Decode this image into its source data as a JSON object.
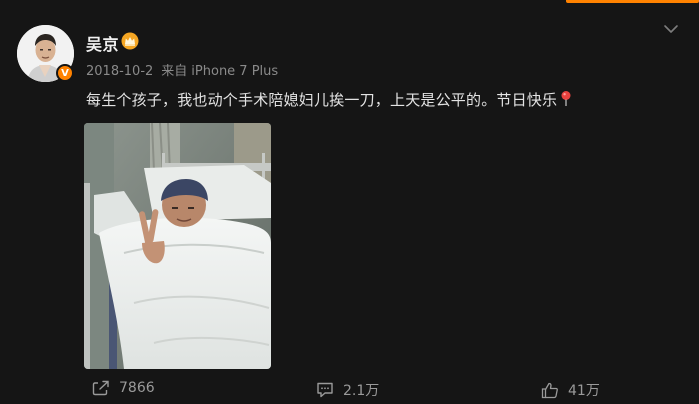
{
  "post": {
    "author": "吴京",
    "date": "2018-10-2",
    "source_prefix": "来自",
    "device": "iPhone 7 Plus",
    "text": "每生个孩子，我也动个手术陪媳妇儿挨一刀，上天是公平的。节日快乐",
    "verified_badge": "V"
  },
  "actions": {
    "repost_count": "7866",
    "comment_count": "2.1万",
    "like_count": "41万"
  },
  "icons": {
    "crown": "member-crown-icon",
    "chevron": "chevron-down-icon",
    "pin": "red-pin-icon",
    "repost": "repost-icon",
    "comment": "comment-icon",
    "like": "thumbs-up-icon"
  },
  "colors": {
    "background": "#151515",
    "accent": "#ff8200",
    "muted_text": "#8a8a8a",
    "text": "#e3e3e3"
  }
}
